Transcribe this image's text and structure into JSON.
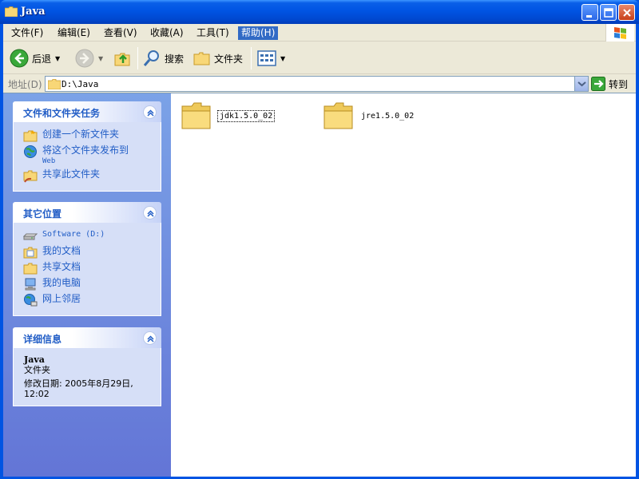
{
  "window": {
    "title": "Java"
  },
  "menu": {
    "items": [
      {
        "label": "文件(F)"
      },
      {
        "label": "编辑(E)"
      },
      {
        "label": "查看(V)"
      },
      {
        "label": "收藏(A)"
      },
      {
        "label": "工具(T)"
      },
      {
        "label": "帮助(H)"
      }
    ]
  },
  "toolbar": {
    "back_label": "后退",
    "search_label": "搜索",
    "folders_label": "文件夹"
  },
  "address": {
    "label": "地址(D)",
    "value": "D:\\Java",
    "go_label": "转到"
  },
  "tasks": {
    "file_tasks": {
      "title": "文件和文件夹任务",
      "items": [
        {
          "label": "创建一个新文件夹"
        },
        {
          "label": "将这个文件夹发布到",
          "sub": "Web"
        },
        {
          "label": "共享此文件夹"
        }
      ]
    },
    "other_places": {
      "title": "其它位置",
      "items": [
        {
          "label": "Software (D:)"
        },
        {
          "label": "我的文档"
        },
        {
          "label": "共享文档"
        },
        {
          "label": "我的电脑"
        },
        {
          "label": "网上邻居"
        }
      ]
    },
    "details": {
      "title": "详细信息",
      "name": "Java",
      "type": "文件夹",
      "modified_line1": "修改日期: 2005年8月29日,",
      "modified_line2": "12:02"
    }
  },
  "files": [
    {
      "name": "jdk1.5.0_02"
    },
    {
      "name": "jre1.5.0_02"
    }
  ],
  "colors": {
    "titlebar": "#0054e3",
    "taskpane": "#6d8ee0",
    "link": "#215dc6",
    "menu_active": "#316ac5"
  }
}
